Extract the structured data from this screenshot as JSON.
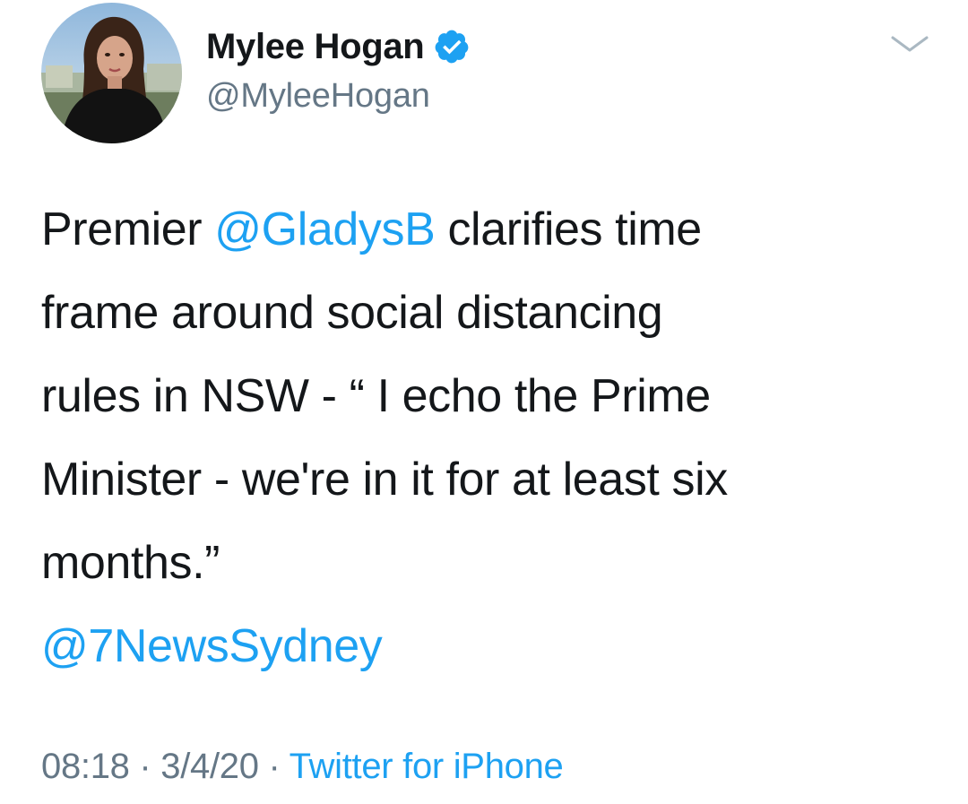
{
  "author": {
    "display_name": "Mylee Hogan",
    "handle": "@MyleeHogan",
    "verified_icon": "verified-badge-icon",
    "avatar_description": "profile-photo"
  },
  "menu": {
    "icon": "chevron-down-icon"
  },
  "tweet": {
    "lines": [
      {
        "before": "Premier ",
        "mention": "@GladysB",
        "after": " clarifies time"
      },
      {
        "text": "frame around social distancing"
      },
      {
        "text": "rules in NSW - “ I echo the Prime"
      },
      {
        "text": "Minister - we're in it for at least six"
      },
      {
        "text": "months.”"
      }
    ],
    "trailing_mention": "@7NewsSydney"
  },
  "meta": {
    "time": "08:18",
    "separator1": " · ",
    "date": "3/4/20",
    "separator2": " · ",
    "source": "Twitter for iPhone"
  },
  "colors": {
    "link": "#1da1f2",
    "secondary_text": "#657786",
    "primary_text": "#14171a"
  }
}
